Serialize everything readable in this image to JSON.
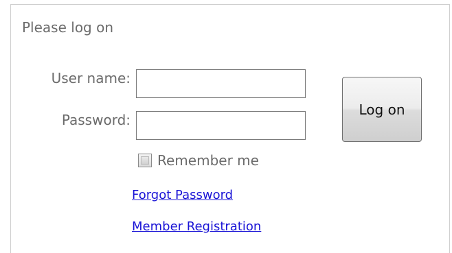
{
  "login": {
    "title": "Please log on",
    "username_label": "User name:",
    "username_value": "",
    "password_label": "Password:",
    "password_value": "",
    "remember_label": "Remember me",
    "remember_checked": false,
    "logon_button": "Log on",
    "forgot_password_link": "Forgot Password",
    "member_registration_link": "Member Registration"
  },
  "colors": {
    "label_text": "#6b6b6b",
    "link": "#1a14d6",
    "border": "#cfcfcf"
  }
}
